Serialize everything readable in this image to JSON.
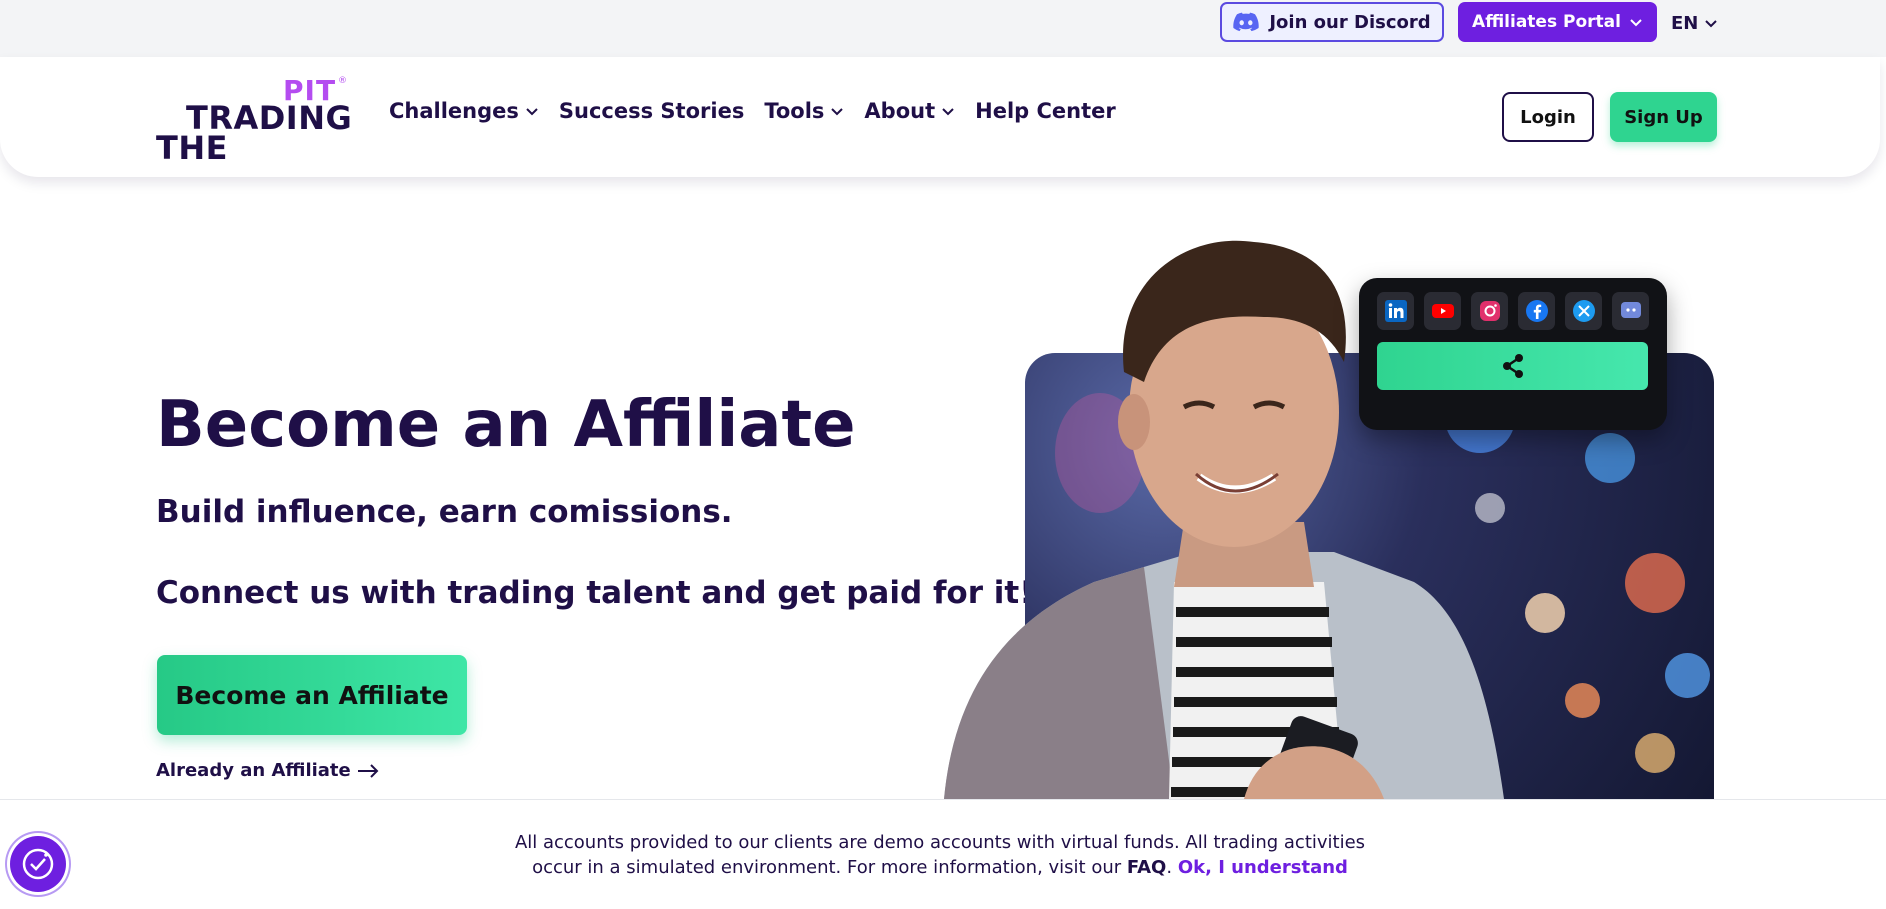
{
  "topbar": {
    "discord_label": "Join our Discord",
    "affiliates_label": "Affiliates Portal",
    "language": "EN"
  },
  "logo": {
    "line1": "PIT",
    "line2": "TRADING",
    "line3": "THE",
    "reg": "®"
  },
  "nav": {
    "items": [
      {
        "label": "Challenges",
        "dropdown": true
      },
      {
        "label": "Success Stories",
        "dropdown": false
      },
      {
        "label": "Tools",
        "dropdown": true
      },
      {
        "label": "About",
        "dropdown": true
      },
      {
        "label": "Help Center",
        "dropdown": false
      }
    ],
    "login": "Login",
    "signup": "Sign Up"
  },
  "hero": {
    "title": "Become an Affiliate",
    "subtitle1": "Build influence, earn comissions.",
    "subtitle2": "Connect us with trading talent and get paid for it!",
    "cta": "Become an Affiliate",
    "already": "Already an Affiliate"
  },
  "social_card": {
    "icons": [
      "linkedin-icon",
      "youtube-icon",
      "instagram-icon",
      "facebook-icon",
      "x-icon",
      "discord-icon"
    ]
  },
  "cookie": {
    "text_line1": "All accounts provided to our clients are demo accounts with virtual funds. All trading activities",
    "text_line2": "occur in a simulated environment. For more information, visit our",
    "faq": "FAQ",
    "ok": "Ok, I understand"
  },
  "colors": {
    "primary_purple": "#6e1fe0",
    "brand_navy": "#1f0f47",
    "accent_green": "#2fd490",
    "logo_purple": "#b44cf0"
  }
}
